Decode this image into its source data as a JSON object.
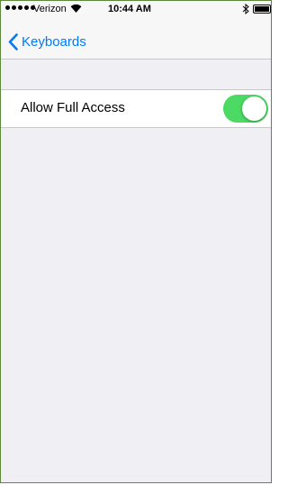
{
  "status_bar": {
    "carrier": "Verizon",
    "time": "10:44 AM",
    "signal_bars_filled": 5,
    "wifi_icon": "wifi-icon",
    "bluetooth_icon": "bluetooth-icon",
    "battery_icon": "battery-icon"
  },
  "nav": {
    "back_label": "Keyboards",
    "back_icon": "chevron-left-icon"
  },
  "settings": {
    "full_access": {
      "label": "Allow Full Access",
      "enabled": true
    }
  },
  "colors": {
    "accent": "#007aff",
    "toggle_on": "#4cd964",
    "background": "#efeff4"
  }
}
